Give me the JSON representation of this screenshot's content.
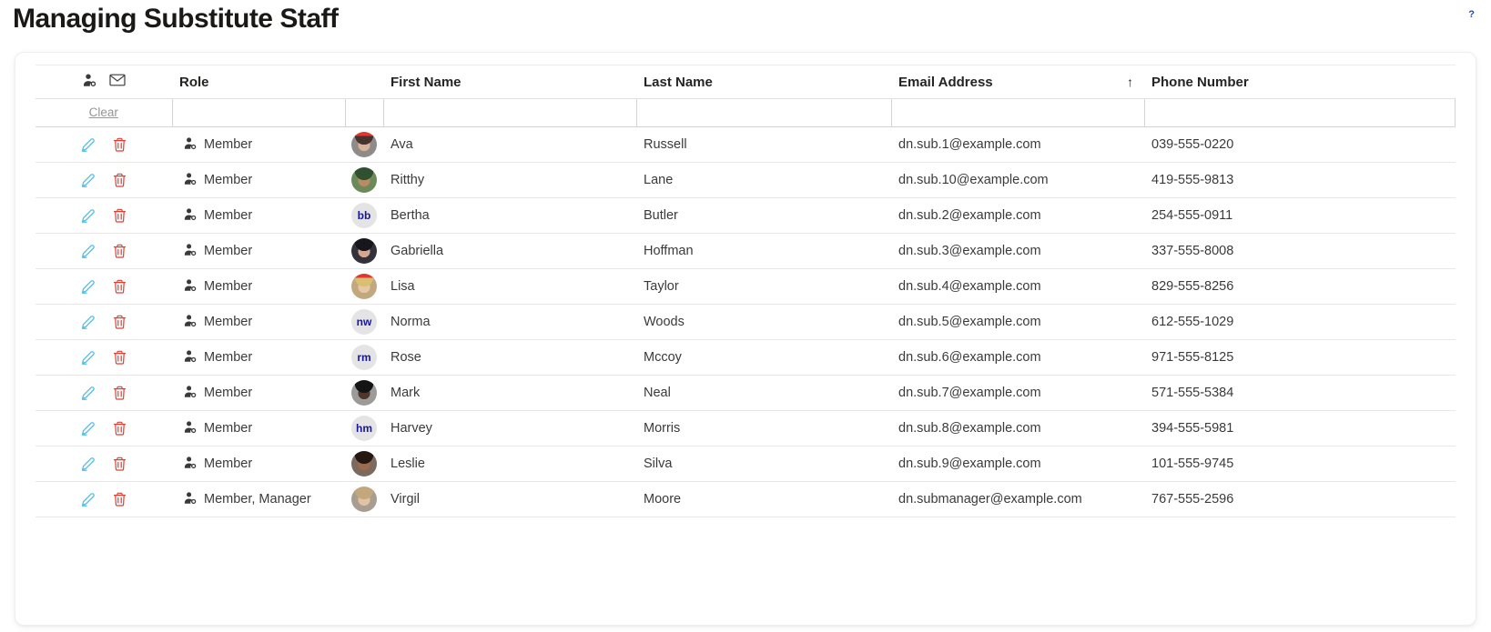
{
  "page": {
    "title": "Managing Substitute Staff",
    "help_glyph": "?"
  },
  "colors": {
    "title_text": "#1a1918",
    "help_icon": "#2b4a9e",
    "edit_icon": "#53bde8",
    "delete_icon": "#e23e32",
    "initials_bg": "#e4e4e4",
    "initials_text": "#17179c"
  },
  "table": {
    "headers": {
      "role": "Role",
      "first_name": "First Name",
      "last_name": "Last Name",
      "email": "Email Address",
      "phone": "Phone Number"
    },
    "header_icons": [
      "person-badge-icon",
      "envelope-icon"
    ],
    "sort": {
      "column": "Email Address",
      "direction": "ascending",
      "glyph": "↑"
    },
    "filters": {
      "clear_label": "Clear",
      "role_value": "",
      "first_name_value": "",
      "last_name_value": "",
      "email_value": "",
      "phone_value": ""
    },
    "rows": [
      {
        "role": "Member",
        "first": "Ava",
        "last": "Russell",
        "email": "dn.sub.1@example.com",
        "phone": "039-555-0220",
        "avatar": {
          "type": "photo",
          "colors": {
            "bg": "#8f8b89",
            "hair": "#46332d",
            "skin": "#d8b29a",
            "banner": "#e0382e"
          }
        }
      },
      {
        "role": "Member",
        "first": "Ritthy",
        "last": "Lane",
        "email": "dn.sub.10@example.com",
        "phone": "419-555-9813",
        "avatar": {
          "type": "photo",
          "colors": {
            "bg": "#6b8a5a",
            "hair": "#31502f",
            "skin": "#b98b63"
          }
        }
      },
      {
        "role": "Member",
        "first": "Bertha",
        "last": "Butler",
        "email": "dn.sub.2@example.com",
        "phone": "254-555-0911",
        "avatar": {
          "type": "initials",
          "initials": "bb"
        }
      },
      {
        "role": "Member",
        "first": "Gabriella",
        "last": "Hoffman",
        "email": "dn.sub.3@example.com",
        "phone": "337-555-8008",
        "avatar": {
          "type": "photo",
          "colors": {
            "bg": "#33323b",
            "hair": "#17161c",
            "skin": "#d3a893"
          }
        }
      },
      {
        "role": "Member",
        "first": "Lisa",
        "last": "Taylor",
        "email": "dn.sub.4@example.com",
        "phone": "829-555-8256",
        "avatar": {
          "type": "photo",
          "colors": {
            "bg": "#c2a87e",
            "hair": "#d9bf72",
            "skin": "#e6c8a6",
            "banner": "#e0382e"
          }
        }
      },
      {
        "role": "Member",
        "first": "Norma",
        "last": "Woods",
        "email": "dn.sub.5@example.com",
        "phone": "612-555-1029",
        "avatar": {
          "type": "initials",
          "initials": "nw"
        }
      },
      {
        "role": "Member",
        "first": "Rose",
        "last": "Mccoy",
        "email": "dn.sub.6@example.com",
        "phone": "971-555-8125",
        "avatar": {
          "type": "initials",
          "initials": "rm"
        }
      },
      {
        "role": "Member",
        "first": "Mark",
        "last": "Neal",
        "email": "dn.sub.7@example.com",
        "phone": "571-555-5384",
        "avatar": {
          "type": "photo",
          "colors": {
            "bg": "#9b9b99",
            "hair": "#141414",
            "skin": "#4f372a"
          }
        }
      },
      {
        "role": "Member",
        "first": "Harvey",
        "last": "Morris",
        "email": "dn.sub.8@example.com",
        "phone": "394-555-5981",
        "avatar": {
          "type": "initials",
          "initials": "hm"
        }
      },
      {
        "role": "Member",
        "first": "Leslie",
        "last": "Silva",
        "email": "dn.sub.9@example.com",
        "phone": "101-555-9745",
        "avatar": {
          "type": "photo",
          "colors": {
            "bg": "#7d6a5e",
            "hair": "#241812",
            "skin": "#9c6a4c"
          }
        }
      },
      {
        "role": "Member, Manager",
        "first": "Virgil",
        "last": "Moore",
        "email": "dn.submanager@example.com",
        "phone": "767-555-2596",
        "avatar": {
          "type": "photo",
          "colors": {
            "bg": "#a79d90",
            "hair": "#c3a87e",
            "skin": "#e2c2a2"
          }
        }
      }
    ]
  }
}
